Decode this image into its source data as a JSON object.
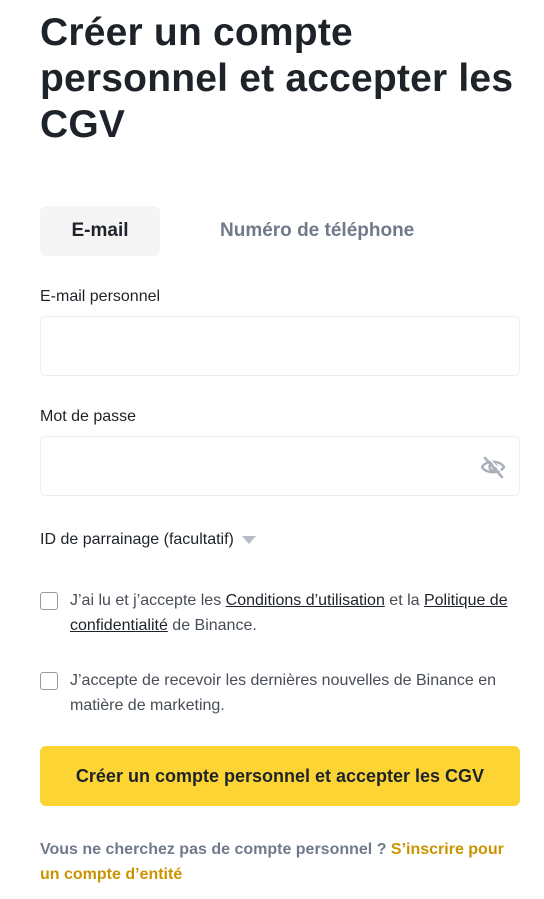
{
  "title": "Créer un compte personnel et accepter les CGV",
  "tabs": {
    "email": "E-mail",
    "phone": "Numéro de téléphone"
  },
  "email_field": {
    "label": "E-mail personnel",
    "value": "",
    "placeholder": ""
  },
  "password_field": {
    "label": "Mot de passe",
    "value": "",
    "placeholder": "",
    "visibility_icon": "eye-slash-icon"
  },
  "referral": {
    "label": "ID de parrainage (facultatif)",
    "icon": "caret-down-icon"
  },
  "terms": {
    "checked": false,
    "prefix": "J’ai lu et j’accepte les ",
    "terms_link": "Conditions d’utilisation",
    "middle": " et la ",
    "privacy_link": "Politique de confidentialité",
    "suffix": " de Binance."
  },
  "marketing": {
    "checked": false,
    "text": "J’accepte de recevoir les dernières nouvelles de Binance en matière de marketing."
  },
  "submit_label": "Créer un compte personnel et accepter les CGV",
  "footer": {
    "text": "Vous ne cherchez pas de compte personnel ? ",
    "link": "S’inscrire pour un compte d’entité"
  },
  "colors": {
    "accent": "#fcd535",
    "link_gold": "#c99400",
    "text_primary": "#1e2329",
    "text_secondary": "#707a8a",
    "border": "#eaecef"
  }
}
